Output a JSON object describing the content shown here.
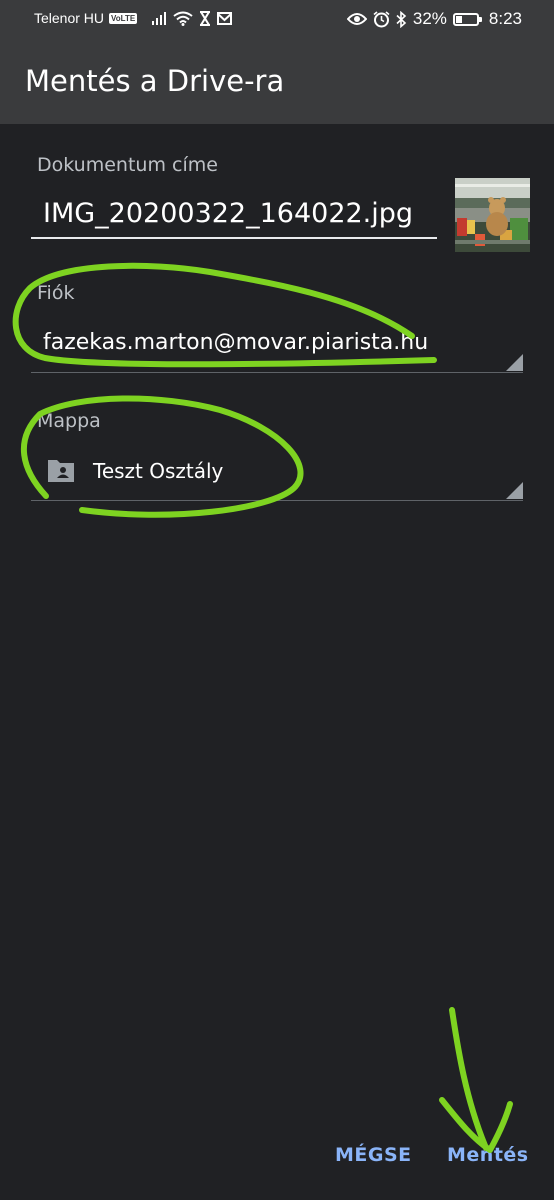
{
  "status_bar": {
    "carrier": "Telenor HU",
    "volte": "VoLTE",
    "battery_percent": "32%",
    "battery_level": 0.32,
    "time": "8:23",
    "icons": [
      "signal-icon",
      "wifi-icon",
      "hourglass-icon",
      "mail-icon",
      "eye-icon",
      "alarm-icon",
      "bluetooth-icon",
      "battery-icon"
    ]
  },
  "app_bar": {
    "title": "Mentés a Drive-ra"
  },
  "form": {
    "document_title_label": "Dokumentum címe",
    "document_title_value": "IMG_20200322_164022.jpg",
    "account_label": "Fiók",
    "account_value": "fazekas.marton@movar.piarista.hu",
    "folder_label": "Mappa",
    "folder_value": "Teszt Osztály",
    "folder_icon": "shared-folder-icon"
  },
  "actions": {
    "cancel_label": "MÉGSE",
    "save_label": "Mentés"
  },
  "colors": {
    "background": "#202124",
    "app_bar": "#3a3b3d",
    "accent": "#8ab4f8",
    "annotation": "#7ed321"
  }
}
